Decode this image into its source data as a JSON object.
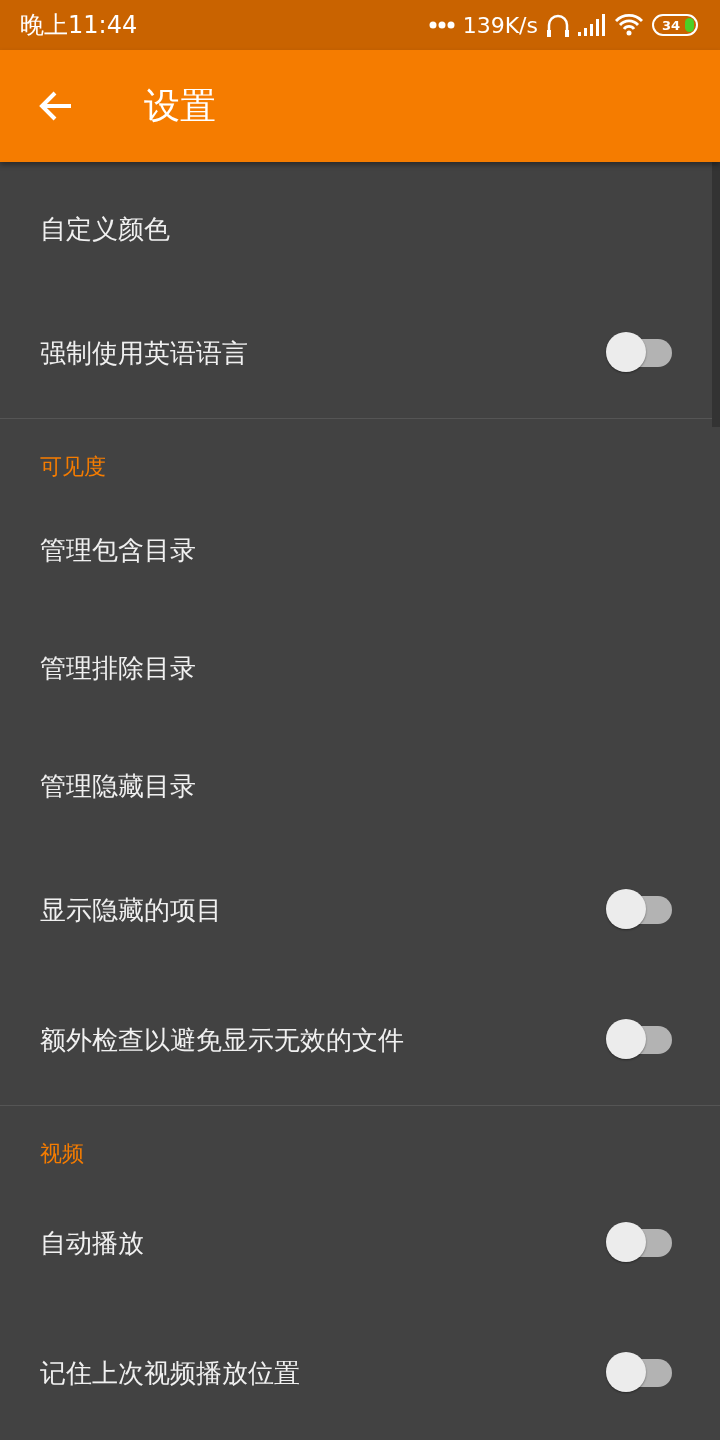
{
  "status_bar": {
    "time": "晚上11:44",
    "speed": "139K/s",
    "battery": "34"
  },
  "app_bar": {
    "title": "设置"
  },
  "sections": [
    {
      "items": [
        {
          "kind": "plain",
          "label": "自定义颜色"
        },
        {
          "kind": "switch",
          "label": "强制使用英语语言",
          "on": false
        }
      ]
    },
    {
      "header": "可见度",
      "items": [
        {
          "kind": "plain",
          "label": "管理包含目录"
        },
        {
          "kind": "plain",
          "label": "管理排除目录"
        },
        {
          "kind": "plain",
          "label": "管理隐藏目录"
        },
        {
          "kind": "switch",
          "label": "显示隐藏的项目",
          "on": false
        },
        {
          "kind": "switch",
          "label": "额外检查以避免显示无效的文件",
          "on": false
        }
      ]
    },
    {
      "header": "视频",
      "items": [
        {
          "kind": "switch",
          "label": "自动播放",
          "on": false
        },
        {
          "kind": "switch",
          "label": "记住上次视频播放位置",
          "on": false
        }
      ]
    }
  ]
}
